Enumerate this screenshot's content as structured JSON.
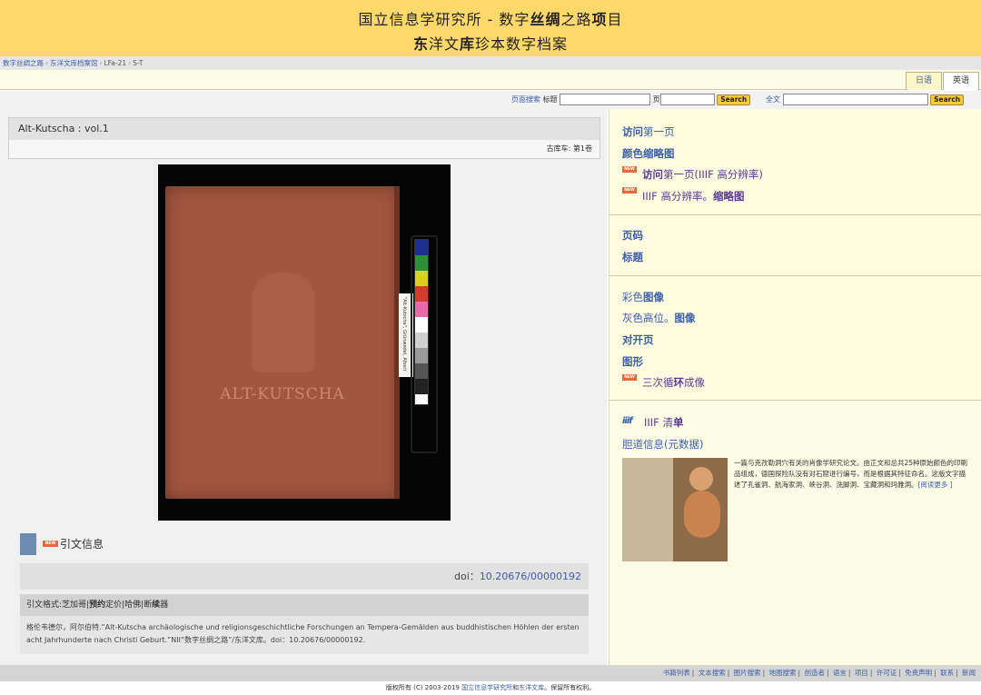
{
  "header": {
    "line1_a": "国立信息学研究所 - 数字",
    "line1_b": "丝绸",
    "line1_c": "之路",
    "line1_d": "项",
    "line1_e": "目",
    "line2_a": "东",
    "line2_b": "洋文",
    "line2_c": "库",
    "line2_d": "珍本数字档案"
  },
  "breadcrumb": [
    "数字丝绸之路",
    "东洋文库档案馆",
    "LFa-21",
    "S-T"
  ],
  "lang_tabs": {
    "japanese": "日语",
    "english": "英语"
  },
  "search": {
    "page_search_link": "页面搜索",
    "title_label": "标题",
    "title_value": "",
    "page_label": "页",
    "page_value": "",
    "button": "Search",
    "fulltext_link": "全文",
    "fulltext_value": "",
    "button2": "Search"
  },
  "book": {
    "title": "Alt-Kutscha : vol.1",
    "volume": "古库车: 第1卷",
    "cover_text": "ALT-KUTSCHA",
    "strip_text": "\"Alt-Kutscha\", Grünwedel, Albert"
  },
  "citation": {
    "new_badge": "NEW",
    "heading": "引文信息",
    "doi_label": "doi：",
    "doi_value": "10.20676/00000192",
    "format_a": "引文格式:芝加哥|",
    "format_b": "预约",
    "format_c": "定价|哈佛|断",
    "format_d": "续",
    "format_e": "器",
    "reference": "格伦韦德尔，阿尔伯特.“Alt-Kutscha archäologische und religionsgeschichtliche Forschungen an Tempera-Gemälden aus buddhistischen Höhlen der ersten acht Jahrhunderte nach Christi Geburt.”NII“数字丝绸之路”/东洋文库。doi：10.20676/00000192."
  },
  "sidebar": {
    "visit_first_b": "访问",
    "visit_first": "第一页",
    "color_thumb_b": "颜色缩略图",
    "new_badge": "NEW",
    "iiif_first_b": "访问",
    "iiif_first_c": "第一页",
    "iiif_first_rest": "(IIIF 高分辨率)",
    "iiif_thumb_a": "IIIF 高分辨率。",
    "iiif_thumb_b": "缩略图",
    "page_no": "页码",
    "title": "标题",
    "color_img_a": "彩色",
    "color_img_b": "图像",
    "gray_img_a": "灰色高位。",
    "gray_img_b": "图像",
    "spread": "对开页",
    "figures": "图形",
    "loop_a": "三次循",
    "loop_b": "环",
    "loop_c": "成像",
    "iiif_logo": "iiif",
    "iiif_list_a": "IIIF 清",
    "iiif_list_b": "单",
    "metadata": "胆道信息(元数据)",
    "description": "一篇与克孜勒洞穴有关的肖像学研究论文。由正文和总共25种原始颜色的印刷品组成，德国探险队没有对石窟进行编号，而是根据其特征命名。这版文字描述了孔雀洞、航海家洞、峡谷洞、洗脚洞、宝藏洞和玛雅洞。",
    "read_more": "[阅读更多 ]"
  },
  "footer": {
    "links": [
      "书籍列表",
      "文本搜索",
      "图片搜索",
      "地图搜索",
      "创造者",
      "语言",
      "项目",
      "许可证",
      "免责声明",
      "联系",
      "新闻"
    ],
    "copyright_a": "版权所有 (C) 2003-2019",
    "copyright_link1": "国立信息学研究所",
    "copyright_and": "和",
    "copyright_link2": "东洋文库",
    "copyright_b": "。保留所有权利。"
  },
  "colors": {
    "header_bg": "#fdd86a",
    "link": "#3a5fa8",
    "new_badge": "#e8683a",
    "panel_bg": "#fdfde6"
  }
}
